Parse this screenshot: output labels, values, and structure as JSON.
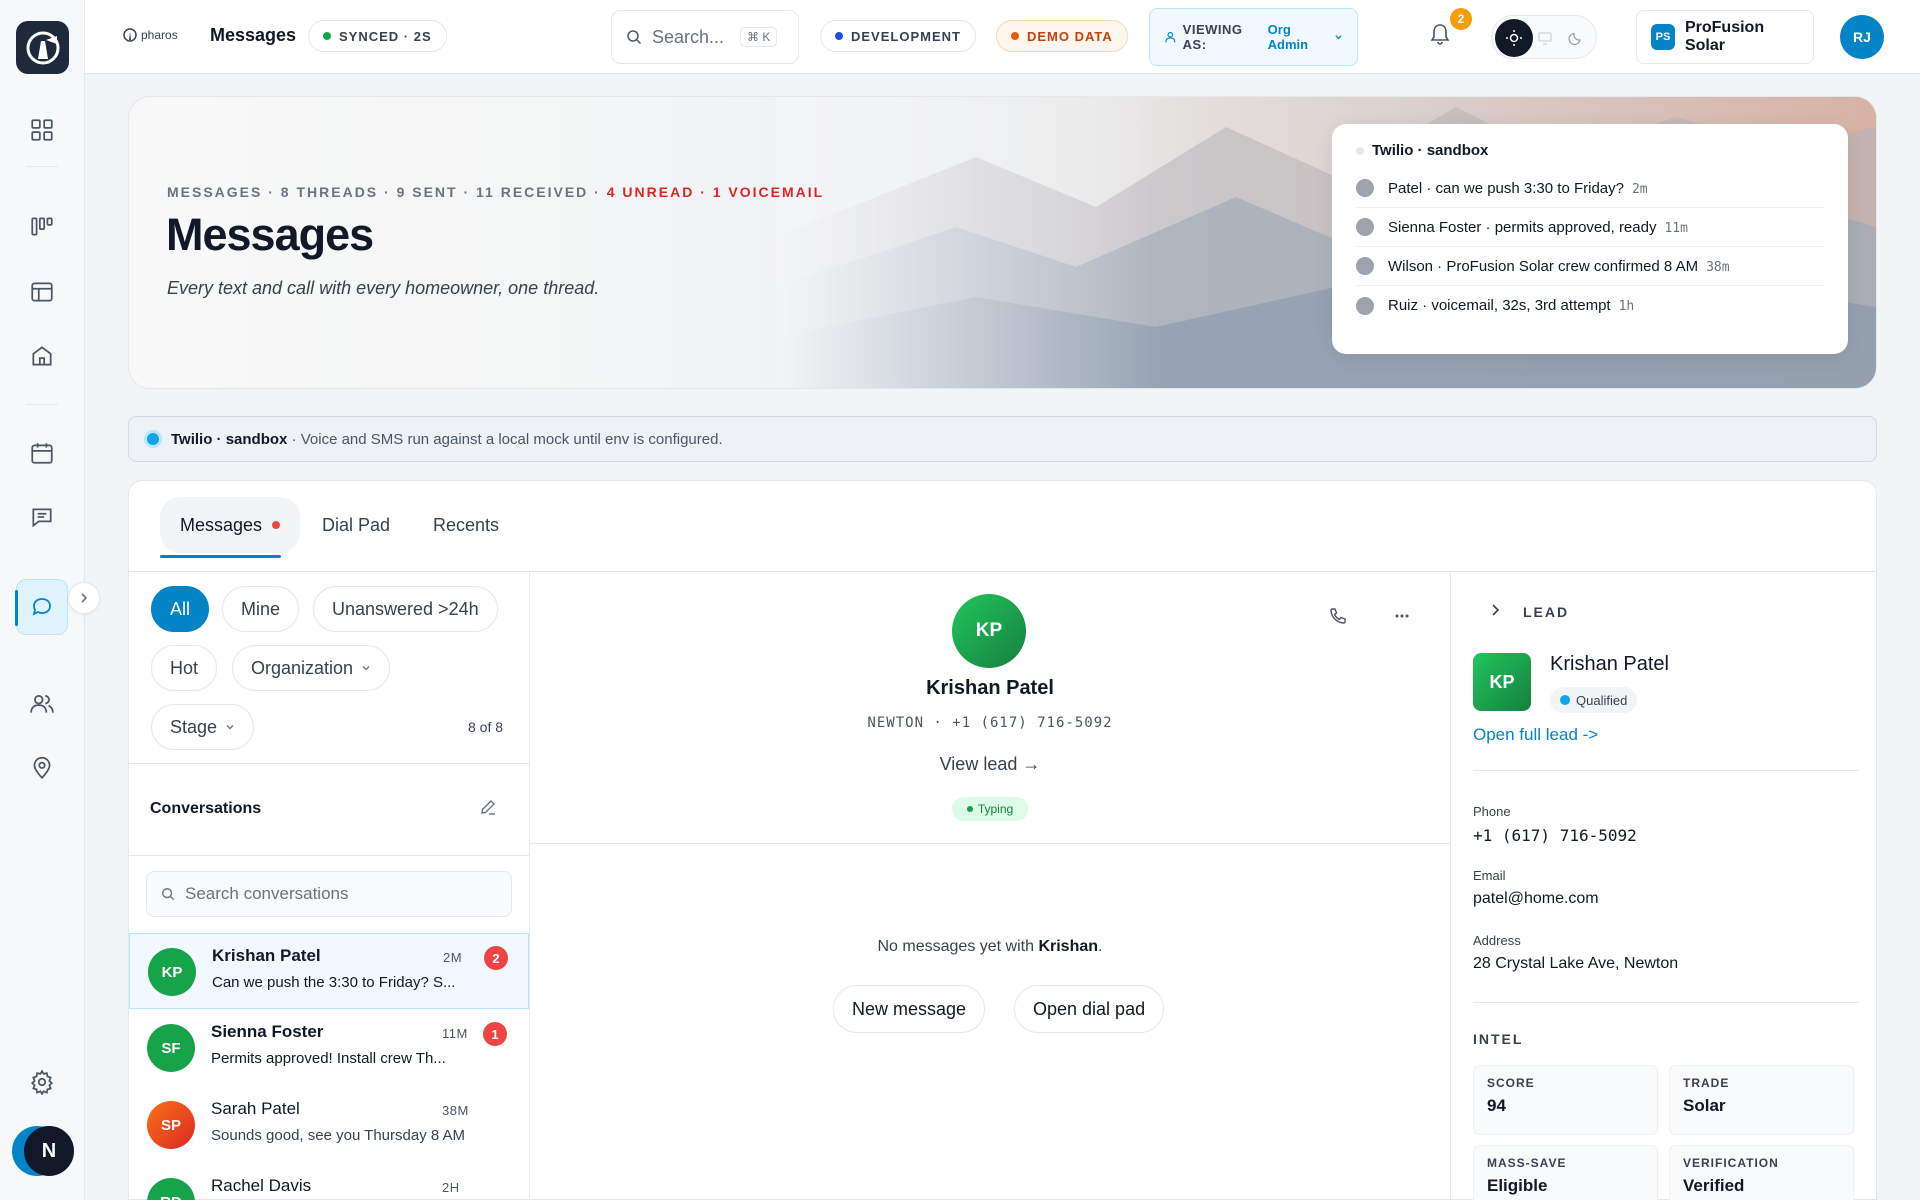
{
  "topbar": {
    "brand": "pharos",
    "page_title": "Messages",
    "sync_status": "SYNCED · 2S",
    "search_placeholder": "Search...",
    "search_shortcut": "⌘ K",
    "env_label": "DEVELOPMENT",
    "demo_label": "DEMO DATA",
    "viewing_label": "VIEWING AS:",
    "viewing_value": "Org Admin",
    "notification_count": "2",
    "org_initials": "PS",
    "org_name": "ProFusion Solar",
    "user_initials": "RJ"
  },
  "sidebar": {
    "user_initial": "N",
    "items": [
      "dashboard-icon",
      "pipeline-icon",
      "table-icon",
      "home-icon",
      "calendar-icon",
      "inbox-icon",
      "messages-icon",
      "people-icon",
      "map-pin-icon",
      "settings-icon"
    ]
  },
  "hero": {
    "meta_main": "MESSAGES · 8 THREADS · 9 SENT · 11 RECEIVED · ",
    "meta_alert": "4 UNREAD · 1 VOICEMAIL",
    "title": "Messages",
    "subtitle": "Every text and call with every homeowner, one thread.",
    "feed_title": "Twilio · sandbox",
    "feed": [
      {
        "text": "Patel · can we push 3:30 to Friday?",
        "time": "2m"
      },
      {
        "text": "Sienna Foster · permits approved, ready",
        "time": "11m"
      },
      {
        "text": "Wilson · ProFusion Solar crew confirmed 8 AM",
        "time": "38m"
      },
      {
        "text": "Ruiz · voicemail, 32s, 3rd attempt",
        "time": "1h"
      }
    ]
  },
  "banner": {
    "strong": "Twilio · sandbox",
    "text": " · Voice and SMS run against a local mock until env is configured."
  },
  "tabs": {
    "messages": "Messages",
    "dialpad": "Dial Pad",
    "recents": "Recents"
  },
  "filters": {
    "all": "All",
    "mine": "Mine",
    "unanswered": "Unanswered >24h",
    "hot": "Hot",
    "organization": "Organization",
    "stage": "Stage",
    "count": "8 of 8"
  },
  "conversations": {
    "title": "Conversations",
    "search_placeholder": "Search conversations",
    "items": [
      {
        "initials": "KP",
        "name": "Krishan Patel",
        "preview": "Can we push the 3:30 to Friday? S...",
        "time": "2M",
        "badge": "2",
        "color": "#16a34a"
      },
      {
        "initials": "SF",
        "name": "Sienna Foster",
        "preview": "Permits approved! Install crew Th...",
        "time": "11M",
        "badge": "1",
        "color": "#16a34a"
      },
      {
        "initials": "SP",
        "name": "Sarah Patel",
        "preview": "Sounds good, see you Thursday 8 AM",
        "time": "38M",
        "badge": "",
        "color": "#ea580c"
      },
      {
        "initials": "RD",
        "name": "Rachel Davis",
        "preview": "",
        "time": "2H",
        "badge": "",
        "color": "#16a34a"
      }
    ]
  },
  "thread": {
    "initials": "KP",
    "name": "Krishan Patel",
    "meta": "NEWTON · +1 (617) 716-5092",
    "view_lead": "View lead →",
    "typing": "Typing",
    "empty_prefix": "No messages yet with ",
    "empty_name": "Krishan",
    "empty_suffix": ".",
    "new_message": "New message",
    "open_dialpad": "Open dial pad"
  },
  "lead": {
    "section": "LEAD",
    "initials": "KP",
    "name": "Krishan Patel",
    "status": "Qualified",
    "open_link": "Open full lead ->",
    "phone_label": "Phone",
    "phone": "+1 (617) 716-5092",
    "email_label": "Email",
    "email": "patel@home.com",
    "address_label": "Address",
    "address": "28 Crystal Lake Ave, Newton",
    "intel_label": "INTEL",
    "intel": [
      {
        "key": "SCORE",
        "value": "94"
      },
      {
        "key": "TRADE",
        "value": "Solar"
      },
      {
        "key": "MASS-SAVE",
        "value": "Eligible"
      },
      {
        "key": "VERIFICATION",
        "value": "Verified"
      }
    ]
  }
}
